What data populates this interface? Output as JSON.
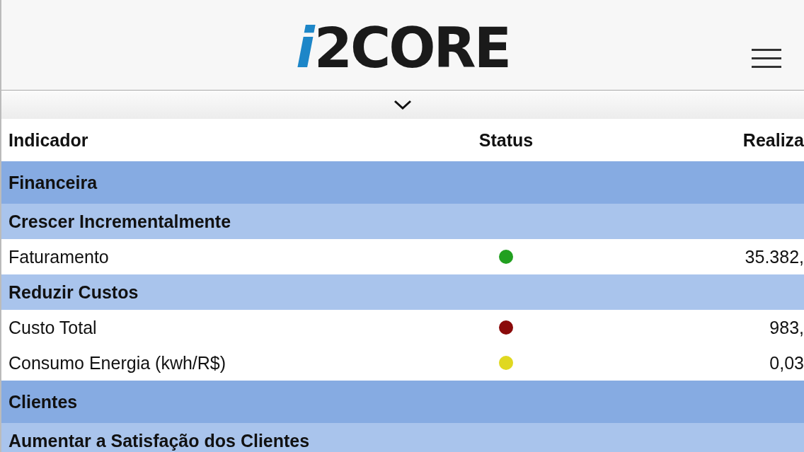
{
  "header": {
    "logo": "i2CORE"
  },
  "table": {
    "columns": [
      "Indicador",
      "Status",
      "Realiza"
    ],
    "rows": [
      {
        "kind": "group",
        "label": "Financeira"
      },
      {
        "kind": "objective",
        "label": "Crescer Incrementalmente"
      },
      {
        "kind": "indicator",
        "label": "Faturamento",
        "color": "#22a020",
        "value": "35.382,"
      },
      {
        "kind": "objective",
        "label": "Reduzir Custos"
      },
      {
        "kind": "indicator",
        "label": "Custo Total",
        "color": "#8a0a0a",
        "value": "983,"
      },
      {
        "kind": "indicator",
        "label": "Consumo Energia (kwh/R$)",
        "color": "#e0d820",
        "value": "0,03"
      },
      {
        "kind": "group",
        "label": "Clientes"
      },
      {
        "kind": "objective",
        "label": "Aumentar a Satisfação dos Clientes"
      }
    ]
  }
}
